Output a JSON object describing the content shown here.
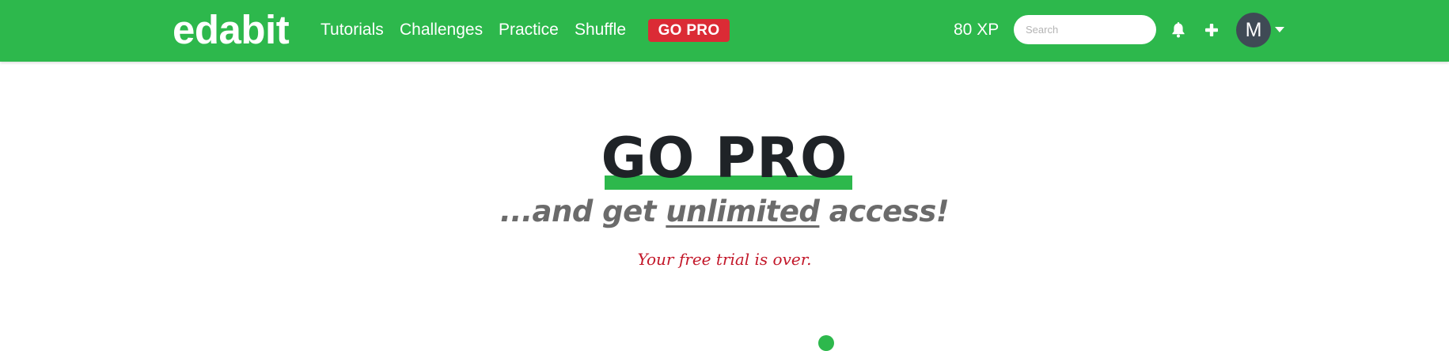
{
  "navbar": {
    "logo": "edabit",
    "links": [
      "Tutorials",
      "Challenges",
      "Practice",
      "Shuffle"
    ],
    "gopro_label": "GO PRO",
    "xp": "80 XP",
    "search_placeholder": "Search",
    "avatar_initial": "M",
    "icons": [
      "bell-icon",
      "plus-icon",
      "chevron-down-icon"
    ]
  },
  "hero": {
    "title": "GO PRO",
    "subtitle_prefix": "...and get ",
    "subtitle_emphasis": "unlimited",
    "subtitle_suffix": " access!",
    "trial_message": "Your free trial is over."
  },
  "colors": {
    "brand_green": "#2db84c",
    "pro_red": "#db2b35",
    "avatar_bg": "#3f4a55",
    "title_dark": "#1f2327",
    "subtitle_gray": "#6b6b6b",
    "warning_red": "#c3182a"
  }
}
